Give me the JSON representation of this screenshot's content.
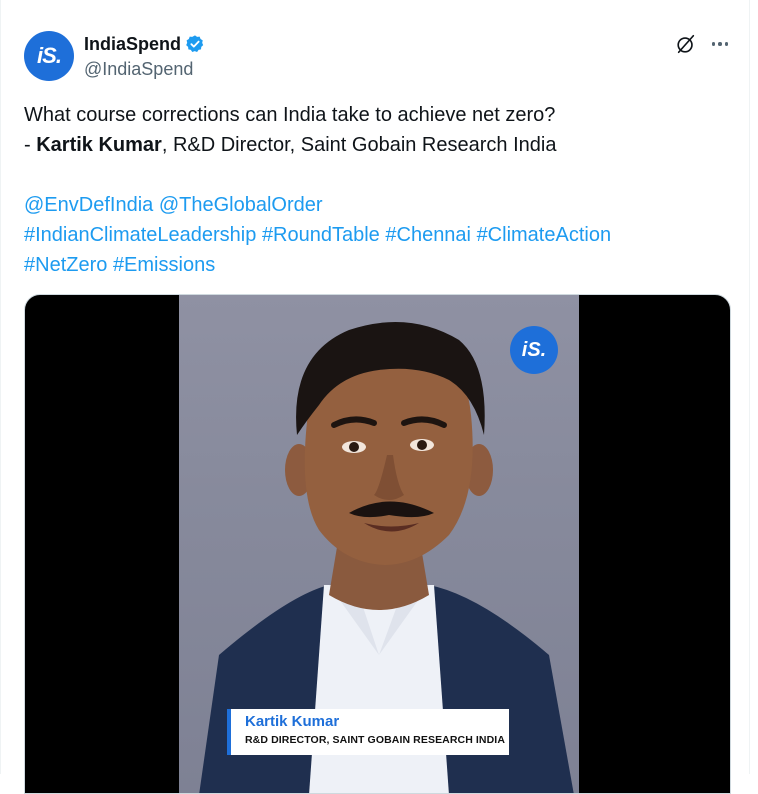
{
  "author": {
    "display_name": "IndiaSpend",
    "handle": "@IndiaSpend",
    "avatar_text": "iS.",
    "verified": true,
    "accent_color": "#1e6fd9"
  },
  "header_actions": {
    "grok_icon": "grok-icon",
    "more_icon": "more-icon"
  },
  "tweet": {
    "question": "What course corrections can India take to achieve net zero?",
    "attribution_prefix": "- ",
    "attribution_name": "Kartik Kumar",
    "attribution_rest": ", R&D Director, Saint Gobain Research India",
    "mentions": [
      "@EnvDefIndia",
      "@TheGlobalOrder"
    ],
    "hashtags_line1": [
      "#IndianClimateLeadership",
      "#RoundTable",
      "#Chennai",
      "#ClimateAction"
    ],
    "hashtags_line2": [
      "#NetZero",
      "#Emissions"
    ]
  },
  "media": {
    "logo_text": "iS.",
    "lower_third_name": "Kartik Kumar",
    "lower_third_title": "R&D DIRECTOR, SAINT GOBAIN RESEARCH INDIA"
  }
}
